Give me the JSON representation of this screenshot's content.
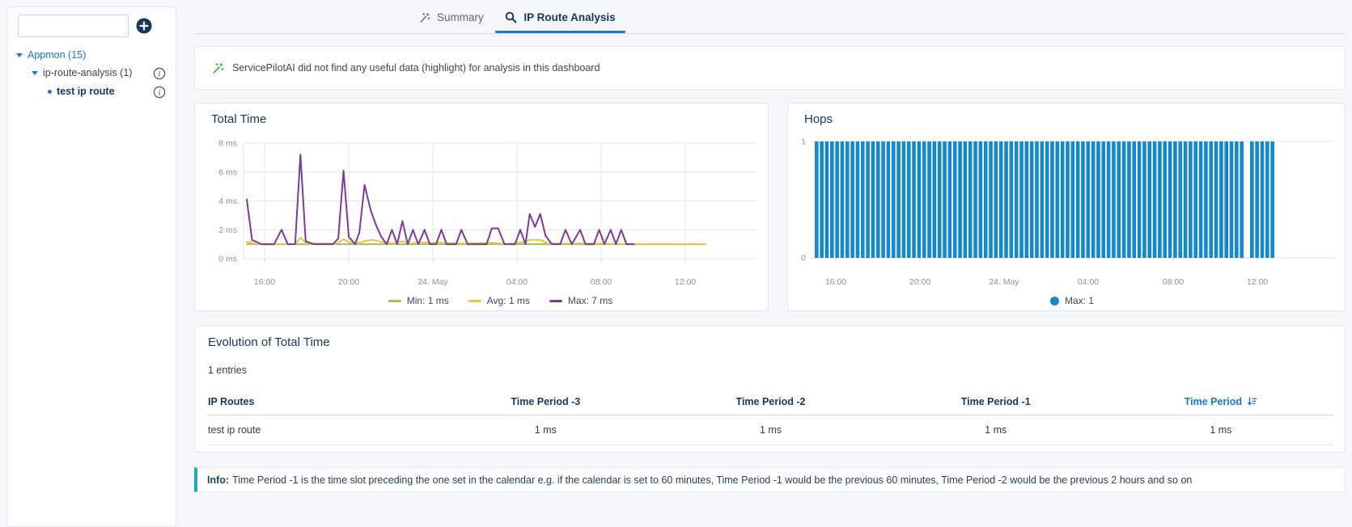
{
  "colors": {
    "accent_blue": "#1877d1",
    "navy": "#17375e",
    "page_bg": "#f4f6f9",
    "teal_info": "#1ba8c0",
    "bar_blue": "#1588c9",
    "line_min_green": "#9bc25b",
    "line_avg_yellow": "#edc240",
    "line_max_purple": "#7e3a97"
  },
  "sidebar": {
    "search": {
      "placeholder": ""
    },
    "add_button": {
      "icon": "plus-circle-icon"
    },
    "tree": {
      "root": {
        "label": "Appmon (15)"
      },
      "group": {
        "label": "ip-route-analysis (1)",
        "info_icon": "info-circle-icon"
      },
      "leaf": {
        "label": "test ip route",
        "info_icon": "info-circle-icon"
      }
    }
  },
  "tabs": [
    {
      "label": "Summary",
      "icon": "wand-icon",
      "active": false
    },
    {
      "label": "IP Route Analysis",
      "icon": "search-icon",
      "active": true
    }
  ],
  "banner": {
    "icon": "wand-sparkles-icon",
    "text": "ServicePilotAI did not find any useful data (highlight) for analysis in this dashboard"
  },
  "chart_data": [
    {
      "type": "line",
      "title": "Total Time",
      "y_unit": "ms",
      "y_range": [
        0,
        8
      ],
      "y_tick_labels": [
        "8 ms",
        "6 ms",
        "4 ms",
        "2 ms",
        "0 ms"
      ],
      "y_tick_values": [
        8,
        6,
        4,
        2,
        0
      ],
      "x_tick_labels": [
        "16:00",
        "20:00",
        "24. May",
        "04:00",
        "08:00",
        "12:00"
      ],
      "grid": true,
      "legend_position": "bottom",
      "series": [
        {
          "name": "Min",
          "legend_label": "Min: 1 ms",
          "color": "#9bc25b",
          "points": [
            [
              0,
              1
            ],
            [
              21.8,
              1
            ]
          ]
        },
        {
          "name": "Avg",
          "legend_label": "Avg: 1 ms",
          "color": "#edc240",
          "points": [
            [
              0,
              1.15
            ],
            [
              0.5,
              1
            ],
            [
              2.3,
              1
            ],
            [
              2.55,
              1.45
            ],
            [
              2.85,
              1.05
            ],
            [
              4.3,
              1.05
            ],
            [
              4.6,
              1.35
            ],
            [
              4.9,
              1.1
            ],
            [
              5.35,
              1.1
            ],
            [
              5.7,
              1.25
            ],
            [
              6,
              1.3
            ],
            [
              6.4,
              1.15
            ],
            [
              6.9,
              1.05
            ],
            [
              7.4,
              1.2
            ],
            [
              7.8,
              1.05
            ],
            [
              8.45,
              1.1
            ],
            [
              9.25,
              1.1
            ],
            [
              10.2,
              1.05
            ],
            [
              11.7,
              1.1
            ],
            [
              12.3,
              1
            ],
            [
              13.2,
              1.15
            ],
            [
              13.45,
              1.3
            ],
            [
              13.95,
              1.3
            ],
            [
              14.3,
              1.05
            ],
            [
              15.2,
              1.05
            ],
            [
              16.8,
              1.05
            ],
            [
              17.8,
              1
            ],
            [
              21.8,
              1
            ]
          ]
        },
        {
          "name": "Max",
          "legend_label": "Max: 7 ms",
          "color": "#7e3a97",
          "points": [
            [
              0,
              4.1
            ],
            [
              0.25,
              1.3
            ],
            [
              0.7,
              1
            ],
            [
              1.3,
              1
            ],
            [
              1.65,
              2
            ],
            [
              1.95,
              1
            ],
            [
              2.3,
              1
            ],
            [
              2.55,
              7.2
            ],
            [
              2.8,
              1.2
            ],
            [
              3.2,
              1
            ],
            [
              3.7,
              1
            ],
            [
              4.1,
              1
            ],
            [
              4.35,
              1.4
            ],
            [
              4.6,
              6.1
            ],
            [
              4.85,
              1.5
            ],
            [
              5.15,
              1
            ],
            [
              5.35,
              1.8
            ],
            [
              5.6,
              5.1
            ],
            [
              5.9,
              3.3
            ],
            [
              6.15,
              2.3
            ],
            [
              6.4,
              1.5
            ],
            [
              6.65,
              1
            ],
            [
              6.9,
              2
            ],
            [
              7.15,
              1
            ],
            [
              7.4,
              2.6
            ],
            [
              7.65,
              1
            ],
            [
              7.9,
              2
            ],
            [
              8.15,
              1
            ],
            [
              8.45,
              2
            ],
            [
              8.7,
              1
            ],
            [
              9,
              1
            ],
            [
              9.25,
              2
            ],
            [
              9.5,
              1
            ],
            [
              9.95,
              1
            ],
            [
              10.2,
              2
            ],
            [
              10.5,
              1
            ],
            [
              10.95,
              1
            ],
            [
              11.4,
              1
            ],
            [
              11.65,
              2.1
            ],
            [
              11.95,
              2.1
            ],
            [
              12.25,
              1
            ],
            [
              12.75,
              1
            ],
            [
              13,
              2
            ],
            [
              13.25,
              1
            ],
            [
              13.45,
              3.1
            ],
            [
              13.7,
              2.2
            ],
            [
              13.95,
              3.1
            ],
            [
              14.2,
              1.6
            ],
            [
              14.5,
              1
            ],
            [
              14.9,
              1
            ],
            [
              15.15,
              2
            ],
            [
              15.45,
              1
            ],
            [
              15.85,
              2
            ],
            [
              16.1,
              1
            ],
            [
              16.5,
              1
            ],
            [
              16.75,
              2
            ],
            [
              17,
              1
            ],
            [
              17.3,
              2
            ],
            [
              17.55,
              1
            ],
            [
              17.8,
              2
            ],
            [
              18.05,
              1
            ],
            [
              18.4,
              1
            ]
          ]
        }
      ]
    },
    {
      "type": "bar",
      "title": "Hops",
      "y_range": [
        0,
        1
      ],
      "y_tick_labels": [
        "1",
        "0"
      ],
      "x_tick_labels": [
        "16:00",
        "20:00",
        "24. May",
        "04:00",
        "08:00",
        "12:00"
      ],
      "bar_color": "#1588c9",
      "legend": [
        {
          "label": "Max: 1",
          "color": "#1588c9"
        }
      ],
      "bars": {
        "count": 90,
        "value": 1,
        "missing_indices": [
          84
        ]
      }
    },
    {
      "type": "table",
      "title": "Evolution of Total Time",
      "entries_label": "1 entries",
      "columns": [
        "IP Routes",
        "Time Period -3",
        "Time Period -2",
        "Time Period -1",
        "Time Period"
      ],
      "sort": {
        "column": "Time Period",
        "direction": "desc",
        "icon": "sort-desc-icon"
      },
      "rows": [
        [
          "test ip route",
          "1 ms",
          "1 ms",
          "1 ms",
          "1 ms"
        ]
      ]
    }
  ],
  "info_bar": {
    "label": "Info:",
    "text": "Time Period -1 is the time slot preceding the one set in the calendar e.g. if the calendar is set to 60 minutes, Time Period -1 would be the previous 60 minutes, Time Period -2 would be the previous 2 hours and so on"
  }
}
